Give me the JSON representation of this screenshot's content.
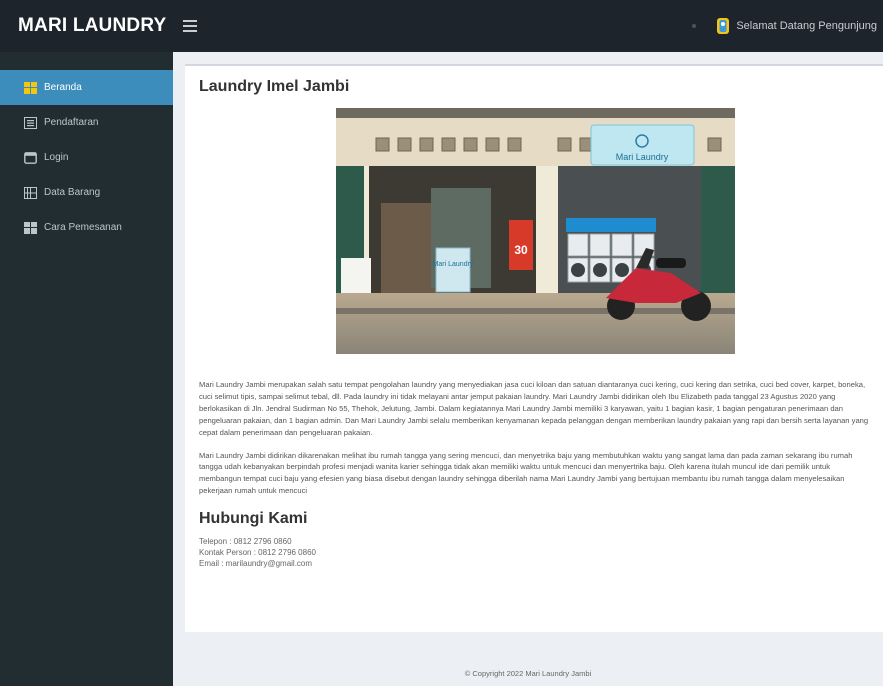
{
  "brand": "MARI LAUNDRY",
  "header": {
    "welcome": "Selamat Datang Pengunjung"
  },
  "sidebar": {
    "items": [
      {
        "label": "Beranda"
      },
      {
        "label": "Pendaftaran"
      },
      {
        "label": "Login"
      },
      {
        "label": "Data Barang"
      },
      {
        "label": "Cara Pemesanan"
      }
    ]
  },
  "main": {
    "title": "Laundry Imel Jambi",
    "photo": {
      "sign": "Mari Laundry",
      "door_sign": "Mari Laundry",
      "banner": "30"
    },
    "paragraphs": [
      "Mari Laundry Jambi merupakan salah satu tempat pengolahan laundry yang menyediakan jasa cuci kiloan dan satuan diantaranya cuci kering, cuci kering dan setrika, cuci bed cover, karpet, boneka, cuci selimut tipis, sampai selimut tebal, dll. Pada laundry ini tidak melayani antar jemput pakaian laundry. Mari Laundry Jambi didirikan oleh Ibu Elizabeth pada tanggal 23 Agustus 2020 yang berlokasikan di Jln. Jendral Sudirman No 55, Thehok, Jelutung, Jambi. Dalam kegiatannya Mari Laundry Jambi memiliki 3 karyawan, yaitu 1 bagian kasir, 1 bagian pengaturan penerimaan dan pengeluaran pakaian, dan 1 bagian admin. Dan Mari Laundry Jambi selalu memberikan kenyamanan kepada pelanggan dengan memberikan laundry pakaian yang rapi dan bersih serta layanan yang cepat dalam penerimaan dan pengeluaran pakaian.",
      "Mari Laundry Jambi didirikan dikarenakan melihat ibu rumah tangga yang sering mencuci, dan menyetrika baju yang membutuhkan waktu yang sangat lama dan pada zaman sekarang ibu rumah tangga udah kebanyakan berpindah profesi menjadi wanita karier sehingga tidak akan memiliki waktu untuk mencuci dan menyertrika baju. Oleh karena itulah muncul ide dari pemilik untuk membangun tempat cuci baju yang efesien yang biasa disebut dengan laundry sehingga diberilah nama Mari Laundry Jambi yang bertujuan membantu ibu rumah tangga dalam menyelesaikan pekerjaan rumah untuk mencuci"
    ],
    "contact": {
      "title": "Hubungi Kami",
      "phone": "Telepon : 0812 2796 0860",
      "person": "Kontak Person : 0812 2796 0860",
      "email": "Email : marilaundry@gmail.com"
    }
  },
  "footer": "© Copyright 2022 Mari Laundry Jambi",
  "colors": {
    "topbar": "#1d242c",
    "sidebar": "#222d32",
    "active": "#3c8dbc",
    "content_bg": "#ecf0f5"
  }
}
